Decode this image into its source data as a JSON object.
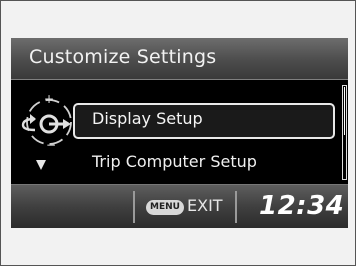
{
  "header": {
    "title": "Customize Settings"
  },
  "menu": {
    "items": [
      {
        "label": "Display Setup",
        "selected": true
      },
      {
        "label": "Trip Computer Setup",
        "selected": false
      }
    ]
  },
  "footer": {
    "menu_button": "MENU",
    "exit_label": "EXIT",
    "clock": "12:34"
  },
  "colors": {
    "screen_bg": "#000000",
    "header_bar": "#5a5a5a",
    "text": "#f2f2f2",
    "highlight_border": "#e8e8e8"
  },
  "icons": [
    "selector-dial-icon",
    "back-arrow-icon",
    "down-arrow-icon",
    "plus-icon",
    "minus-icon"
  ]
}
